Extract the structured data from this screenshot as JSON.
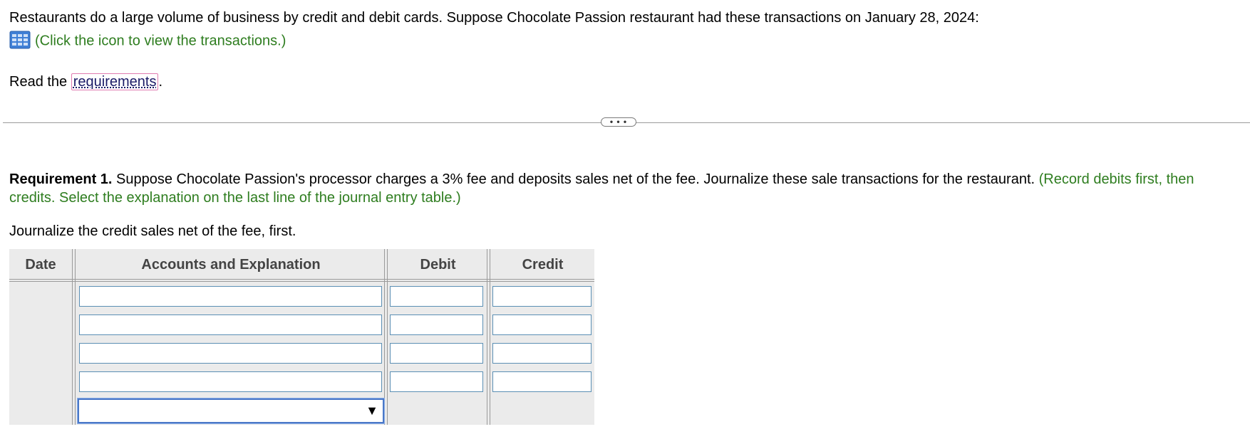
{
  "intro": {
    "text": "Restaurants do a large volume of business by credit and debit cards. Suppose Chocolate Passion restaurant had these transactions on January 28, 2024:",
    "transactions_link": "(Click the icon to view the transactions.)",
    "transactions_icon": "data-table-icon"
  },
  "requirements_line": {
    "prefix": "Read the ",
    "link": "requirements",
    "suffix": "."
  },
  "expand_button": {
    "label": "• • •"
  },
  "requirement1": {
    "bold": "Requirement 1.",
    "text": " Suppose Chocolate Passion's processor charges a 3% fee and deposits sales net of the fee. Journalize these sale transactions for the restaurant. ",
    "green_line1": "(Record debits first, then",
    "green_line2": "credits. Select the explanation on the last line of the journal entry table.)"
  },
  "instruction": "Journalize the credit sales net of the fee, first.",
  "journal": {
    "columns": [
      "Date",
      "Accounts and Explanation",
      "Debit",
      "Credit"
    ],
    "rows": [
      {
        "account": "",
        "debit": "",
        "credit": ""
      },
      {
        "account": "",
        "debit": "",
        "credit": ""
      },
      {
        "account": "",
        "debit": "",
        "credit": ""
      },
      {
        "account": "",
        "debit": "",
        "credit": ""
      }
    ],
    "explanation_select": {
      "selected": "",
      "arrow": "▼"
    }
  },
  "colors": {
    "green_text": "#2e7d1f",
    "table_bg": "#ebebeb",
    "input_border": "#5b8fb4",
    "select_border": "#4a78c8",
    "link_highlight": "#e07bb0"
  }
}
